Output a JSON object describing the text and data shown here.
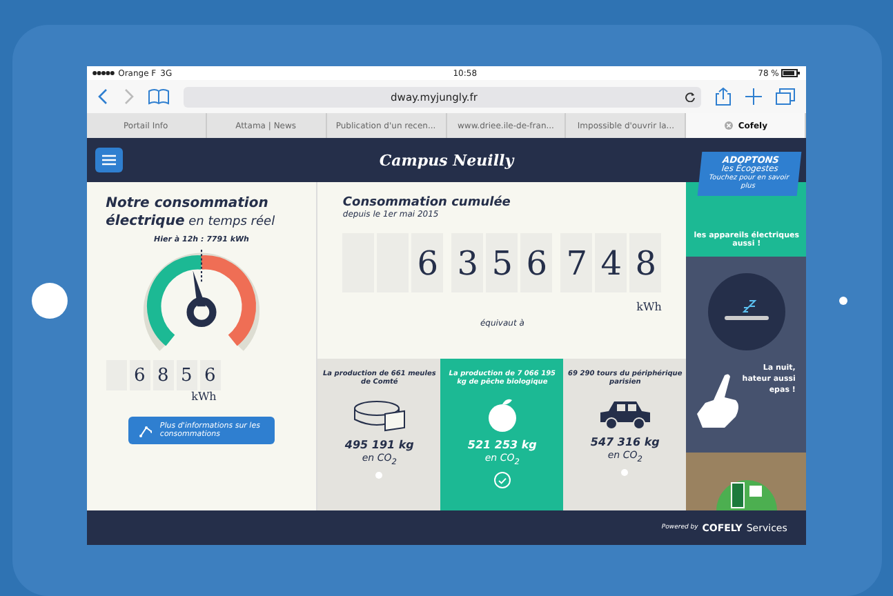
{
  "status_bar": {
    "carrier": "Orange F",
    "network": "3G",
    "time": "10:58",
    "battery": "78 %"
  },
  "address_bar": {
    "url": "dway.myjungly.fr"
  },
  "tabs": [
    {
      "label": "Portail Info",
      "selected": false
    },
    {
      "label": "Attama | News",
      "selected": false
    },
    {
      "label": "Publication d'un recen...",
      "selected": false
    },
    {
      "label": "www.driee.ile-de-fran...",
      "selected": false
    },
    {
      "label": "Impossible d'ouvrir la...",
      "selected": false
    },
    {
      "label": "Cofely",
      "selected": true
    }
  ],
  "header": {
    "title": "Campus Neuilly"
  },
  "live": {
    "title": "**Notre consommation électrique** en temps réel",
    "marker": "Hier à 12h : 7791 kWh",
    "digits": [
      "6",
      "8",
      "5",
      "6"
    ],
    "unit": "kWh",
    "button": "Plus d'informations sur les consommations"
  },
  "cumulative": {
    "title": "Consommation cumulée",
    "subtitle": "depuis le 1er mai 2015",
    "digits": [
      "6",
      "3",
      "5",
      "6",
      "7",
      "4",
      "8"
    ],
    "unit": "kWh",
    "equivalent": "équivaut à"
  },
  "equivalents": [
    {
      "kind": "cheese",
      "selected": false,
      "caption": "La production de 661 meules de Comté",
      "amount": "495 191 kg",
      "co2": "en CO$_{2}$"
    },
    {
      "kind": "peach",
      "selected": true,
      "caption": "La production de 7 066 195 kg de pêche biologique",
      "amount": "521 253 kg",
      "co2": "en CO$_{2}$"
    },
    {
      "kind": "car",
      "selected": false,
      "caption": "69 290 tours du périphérique parisien",
      "amount": "547 316 kg",
      "co2": "en CO$_{2}$"
    }
  ],
  "ecogestes": {
    "badge_title": "ADOPTONS",
    "badge_subtitle": "les Écogestes",
    "badge_hint": "Touchez pour en savoir plus",
    "tip_1": "les appareils électriques aussi !",
    "tip_2": [
      "La nuit,",
      "hateur aussi",
      "epas !"
    ]
  },
  "footer": {
    "powered": "Powered by",
    "brand": "COFELY",
    "brand_2": "Services"
  }
}
